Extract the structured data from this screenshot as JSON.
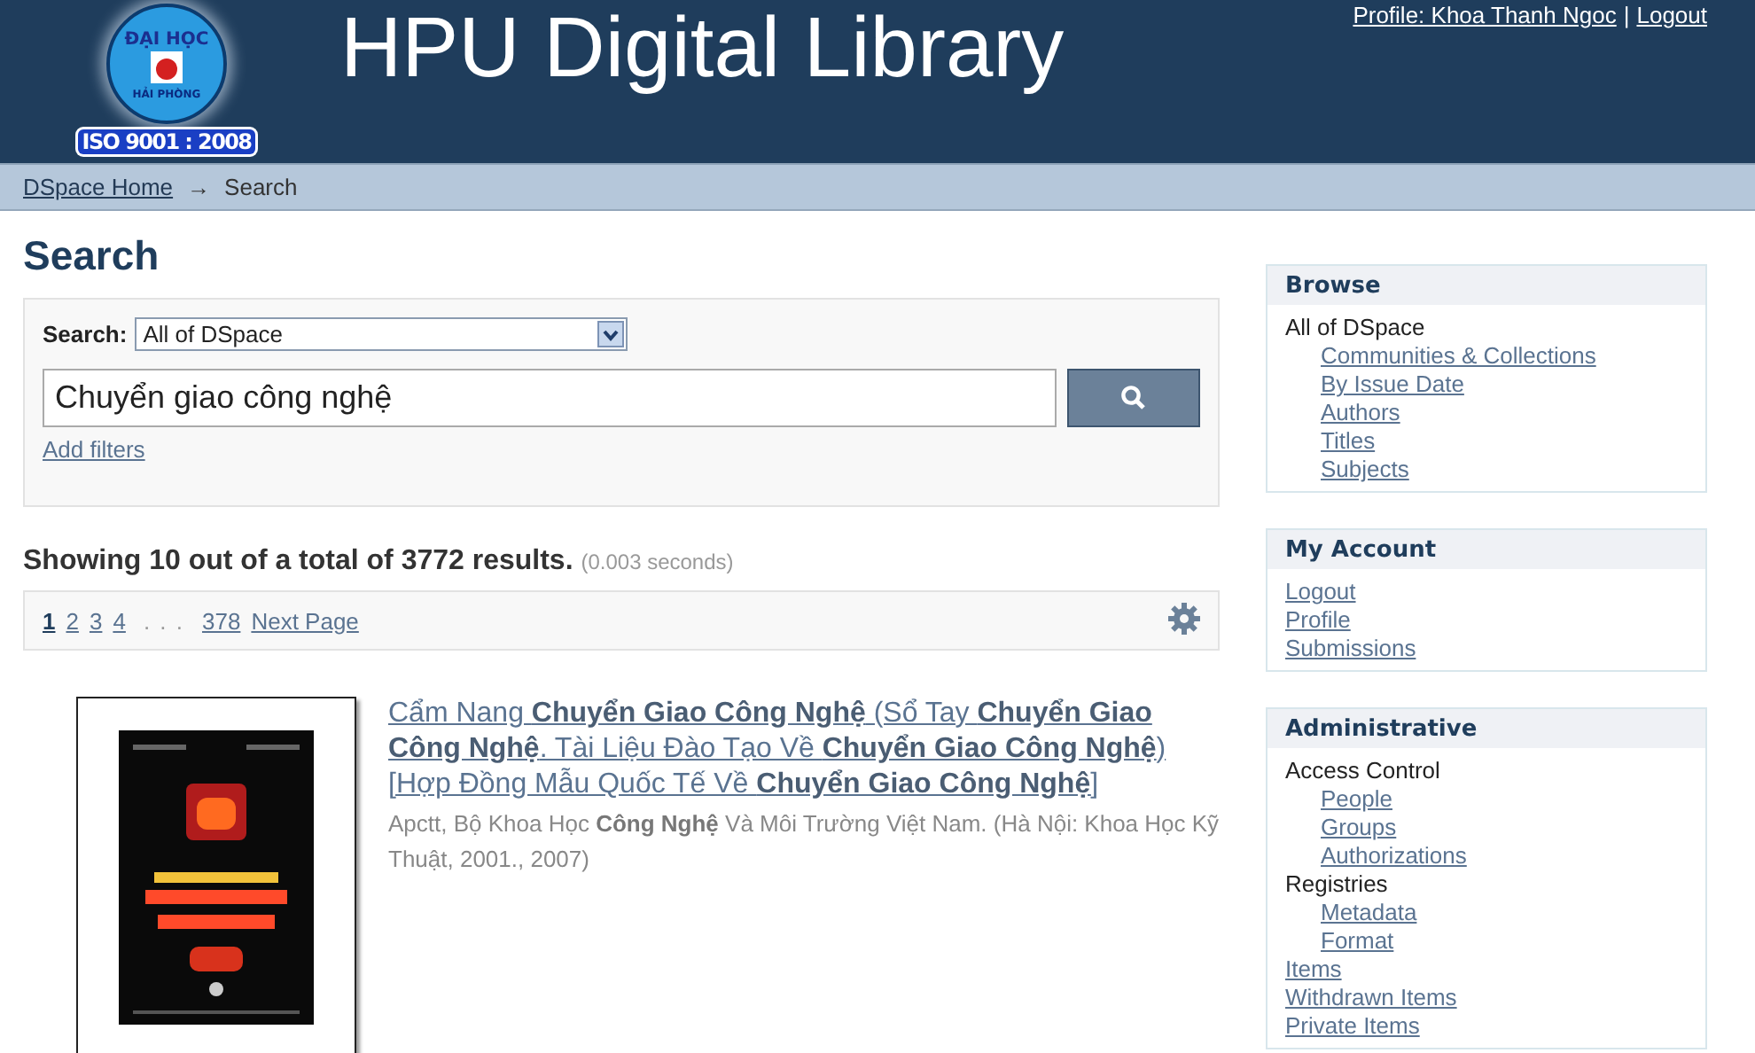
{
  "header": {
    "logo": {
      "top_text": "ĐẠI HỌC",
      "bottom_text": "HẢI PHÒNG",
      "badge": "ISO 9001 : 2008"
    },
    "title": "HPU Digital Library",
    "profile_link": "Profile: Khoa Thanh Ngoc",
    "separator": "|",
    "logout_link": "Logout"
  },
  "breadcrumb": {
    "items": [
      {
        "label": "DSpace Home",
        "kind": "link"
      },
      {
        "label": "→",
        "kind": "arrow"
      },
      {
        "label": "Search",
        "kind": "current"
      }
    ]
  },
  "page_title": "Search",
  "search": {
    "scope_label": "Search:",
    "scope_value": "All of DSpace",
    "query": "Chuyển giao công nghệ",
    "add_filters": "Add filters"
  },
  "results_summary": {
    "text": "Showing 10 out of a total of 3772 results.",
    "timing": "(0.003 seconds)"
  },
  "pagination": {
    "pages": [
      {
        "label": "1",
        "selected": true
      },
      {
        "label": "2",
        "selected": false
      },
      {
        "label": "3",
        "selected": false
      },
      {
        "label": "4",
        "selected": false
      }
    ],
    "ellipsis": ". . .",
    "last_page": "378",
    "next": "Next Page"
  },
  "results": [
    {
      "kind": "picture",
      "title": "Cẩm Nang **Chuyển Giao Công Nghệ** (Sổ Tay **Chuyển Giao Công Nghệ**. Tài Liệu Đào Tạo Về **Chuyển Giao Công Nghệ**) [Hợp Đồng Mẫu Quốc Tế Về **Chuyển Giao Công Nghệ**]",
      "meta": "Apctt, Bộ Khoa Học **Công Nghệ** Và Môi Trường Việt Nam. (Hà Nội: Khoa Học Kỹ Thuật, 2001., 2007)"
    }
  ],
  "sidebar": [
    {
      "title": "Browse",
      "items": [
        {
          "label": "All of DSpace",
          "kind": "heading",
          "children": [
            {
              "label": "Communities & Collections",
              "kind": "link"
            },
            {
              "label": "By Issue Date",
              "kind": "link"
            },
            {
              "label": "Authors",
              "kind": "link"
            },
            {
              "label": "Titles",
              "kind": "link"
            },
            {
              "label": "Subjects",
              "kind": "link"
            }
          ]
        }
      ]
    },
    {
      "title": "My Account",
      "items": [
        {
          "label": "Logout",
          "kind": "link"
        },
        {
          "label": "Profile",
          "kind": "link"
        },
        {
          "label": "Submissions",
          "kind": "link"
        }
      ]
    },
    {
      "title": "Administrative",
      "items": [
        {
          "label": "Access Control",
          "kind": "heading",
          "children": [
            {
              "label": "People",
              "kind": "link"
            },
            {
              "label": "Groups",
              "kind": "link"
            },
            {
              "label": "Authorizations",
              "kind": "link"
            }
          ]
        },
        {
          "label": "Registries",
          "kind": "heading",
          "children": [
            {
              "label": "Metadata",
              "kind": "link"
            },
            {
              "label": "Format",
              "kind": "link"
            }
          ]
        },
        {
          "label": "Items",
          "kind": "link"
        },
        {
          "label": "Withdrawn Items",
          "kind": "link"
        },
        {
          "label": "Private Items",
          "kind": "link"
        }
      ]
    }
  ]
}
